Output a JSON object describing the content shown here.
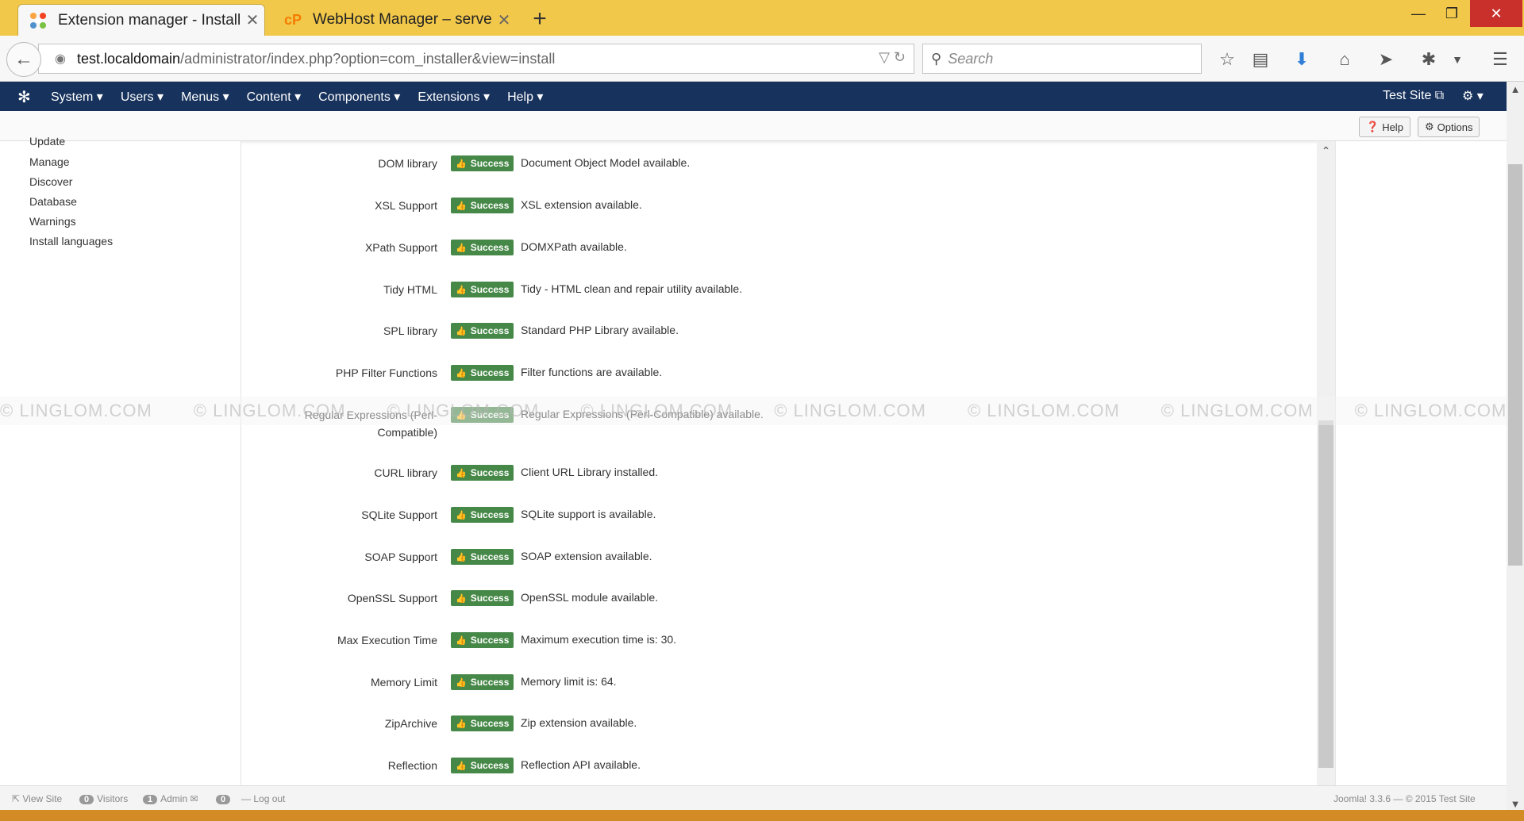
{
  "browser": {
    "tabs": [
      {
        "title": "Extension manager - Install",
        "active": true
      },
      {
        "title": "WebHost Manager – server",
        "active": false
      }
    ],
    "new_tab": "+",
    "url_host": "test.localdomain",
    "url_path": "/administrator/index.php?option=com_installer&view=install",
    "search_placeholder": "Search"
  },
  "joomla_nav": {
    "menu": [
      "System ▾",
      "Users ▾",
      "Menus ▾",
      "Content ▾",
      "Components ▾",
      "Extensions ▾",
      "Help ▾"
    ],
    "site_link": "Test Site ⧉",
    "settings": "⚙ ▾"
  },
  "toolbar": {
    "help": "Help",
    "options": "Options"
  },
  "sidebar": [
    "Update",
    "Manage",
    "Discover",
    "Database",
    "Warnings",
    "Install languages"
  ],
  "status_label": "Success",
  "checks": [
    {
      "label": "DOM library",
      "desc": "Document Object Model available."
    },
    {
      "label": "XSL Support",
      "desc": "XSL extension available."
    },
    {
      "label": "XPath Support",
      "desc": "DOMXPath available."
    },
    {
      "label": "Tidy HTML",
      "desc": "Tidy - HTML clean and repair utility available."
    },
    {
      "label": "SPL library",
      "desc": "Standard PHP Library available."
    },
    {
      "label": "PHP Filter Functions",
      "desc": "Filter functions are available."
    },
    {
      "label": "Regular Expressions (Perl-Compatible)",
      "desc": "Regular Expressions (Perl-Compatible) available."
    },
    {
      "label": "CURL library",
      "desc": "Client URL Library installed."
    },
    {
      "label": "SQLite Support",
      "desc": "SQLite support is available."
    },
    {
      "label": "SOAP Support",
      "desc": "SOAP extension available."
    },
    {
      "label": "OpenSSL Support",
      "desc": "OpenSSL module available."
    },
    {
      "label": "Max Execution Time",
      "desc": "Maximum execution time is: 30."
    },
    {
      "label": "Memory Limit",
      "desc": "Memory limit is: 64."
    },
    {
      "label": "ZipArchive",
      "desc": "Zip extension available."
    },
    {
      "label": "Reflection",
      "desc": "Reflection API available."
    }
  ],
  "status_bar": {
    "view_site": "View Site",
    "visitors_count": "0",
    "visitors": "Visitors",
    "admin_count": "1",
    "admin": "Admin",
    "messages_count": "0",
    "logout": "Log out",
    "version": "Joomla! 3.3.6 — © 2015 Test Site"
  },
  "watermark": "© LINGLOM.COM"
}
